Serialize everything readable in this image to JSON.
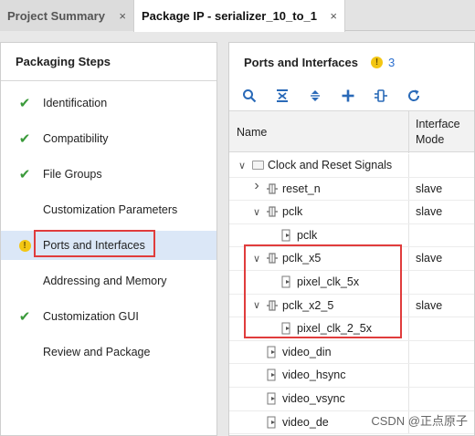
{
  "tabs": [
    {
      "label": "Project Summary",
      "active": false
    },
    {
      "label": "Package IP - serializer_10_to_1",
      "active": true
    }
  ],
  "close_glyph": "×",
  "steps_panel": {
    "title": "Packaging Steps",
    "items": [
      {
        "label": "Identification",
        "status": "done"
      },
      {
        "label": "Compatibility",
        "status": "done"
      },
      {
        "label": "File Groups",
        "status": "done"
      },
      {
        "label": "Customization Parameters",
        "status": "none"
      },
      {
        "label": "Ports and Interfaces",
        "status": "warning",
        "selected": true
      },
      {
        "label": "Addressing and Memory",
        "status": "none"
      },
      {
        "label": "Customization GUI",
        "status": "done"
      },
      {
        "label": "Review and Package",
        "status": "none"
      }
    ]
  },
  "ports_panel": {
    "title": "Ports and Interfaces",
    "warning_count": "3",
    "toolbar": [
      "search-icon",
      "collapse-all-icon",
      "expand-all-icon",
      "add-icon",
      "port-map-icon",
      "refresh-icon"
    ],
    "columns": {
      "name": "Name",
      "mode_line1": "Interface",
      "mode_line2": "Mode"
    },
    "rows": [
      {
        "name": "Clock and Reset Signals",
        "mode": "",
        "kind": "folder",
        "expander": "down"
      },
      {
        "name": "reset_n",
        "mode": "slave",
        "kind": "interface",
        "expander": "right"
      },
      {
        "name": "pclk",
        "mode": "slave",
        "kind": "interface",
        "expander": "down"
      },
      {
        "name": "pclk",
        "mode": "",
        "kind": "port",
        "expander": ""
      },
      {
        "name": "pclk_x5",
        "mode": "slave",
        "kind": "interface",
        "expander": "down"
      },
      {
        "name": "pixel_clk_5x",
        "mode": "",
        "kind": "port",
        "expander": ""
      },
      {
        "name": "pclk_x2_5",
        "mode": "slave",
        "kind": "interface",
        "expander": "down"
      },
      {
        "name": "pixel_clk_2_5x",
        "mode": "",
        "kind": "port",
        "expander": ""
      },
      {
        "name": "video_din",
        "mode": "",
        "kind": "port",
        "expander": ""
      },
      {
        "name": "video_hsync",
        "mode": "",
        "kind": "port",
        "expander": ""
      },
      {
        "name": "video_vsync",
        "mode": "",
        "kind": "port",
        "expander": ""
      },
      {
        "name": "video_de",
        "mode": "",
        "kind": "port",
        "expander": ""
      }
    ]
  },
  "colors": {
    "accent": "#2a6ab8",
    "highlight": "#e03c3c",
    "warning": "#f3c613",
    "check": "#3a9a3a"
  },
  "watermark": "CSDN @正点原子"
}
